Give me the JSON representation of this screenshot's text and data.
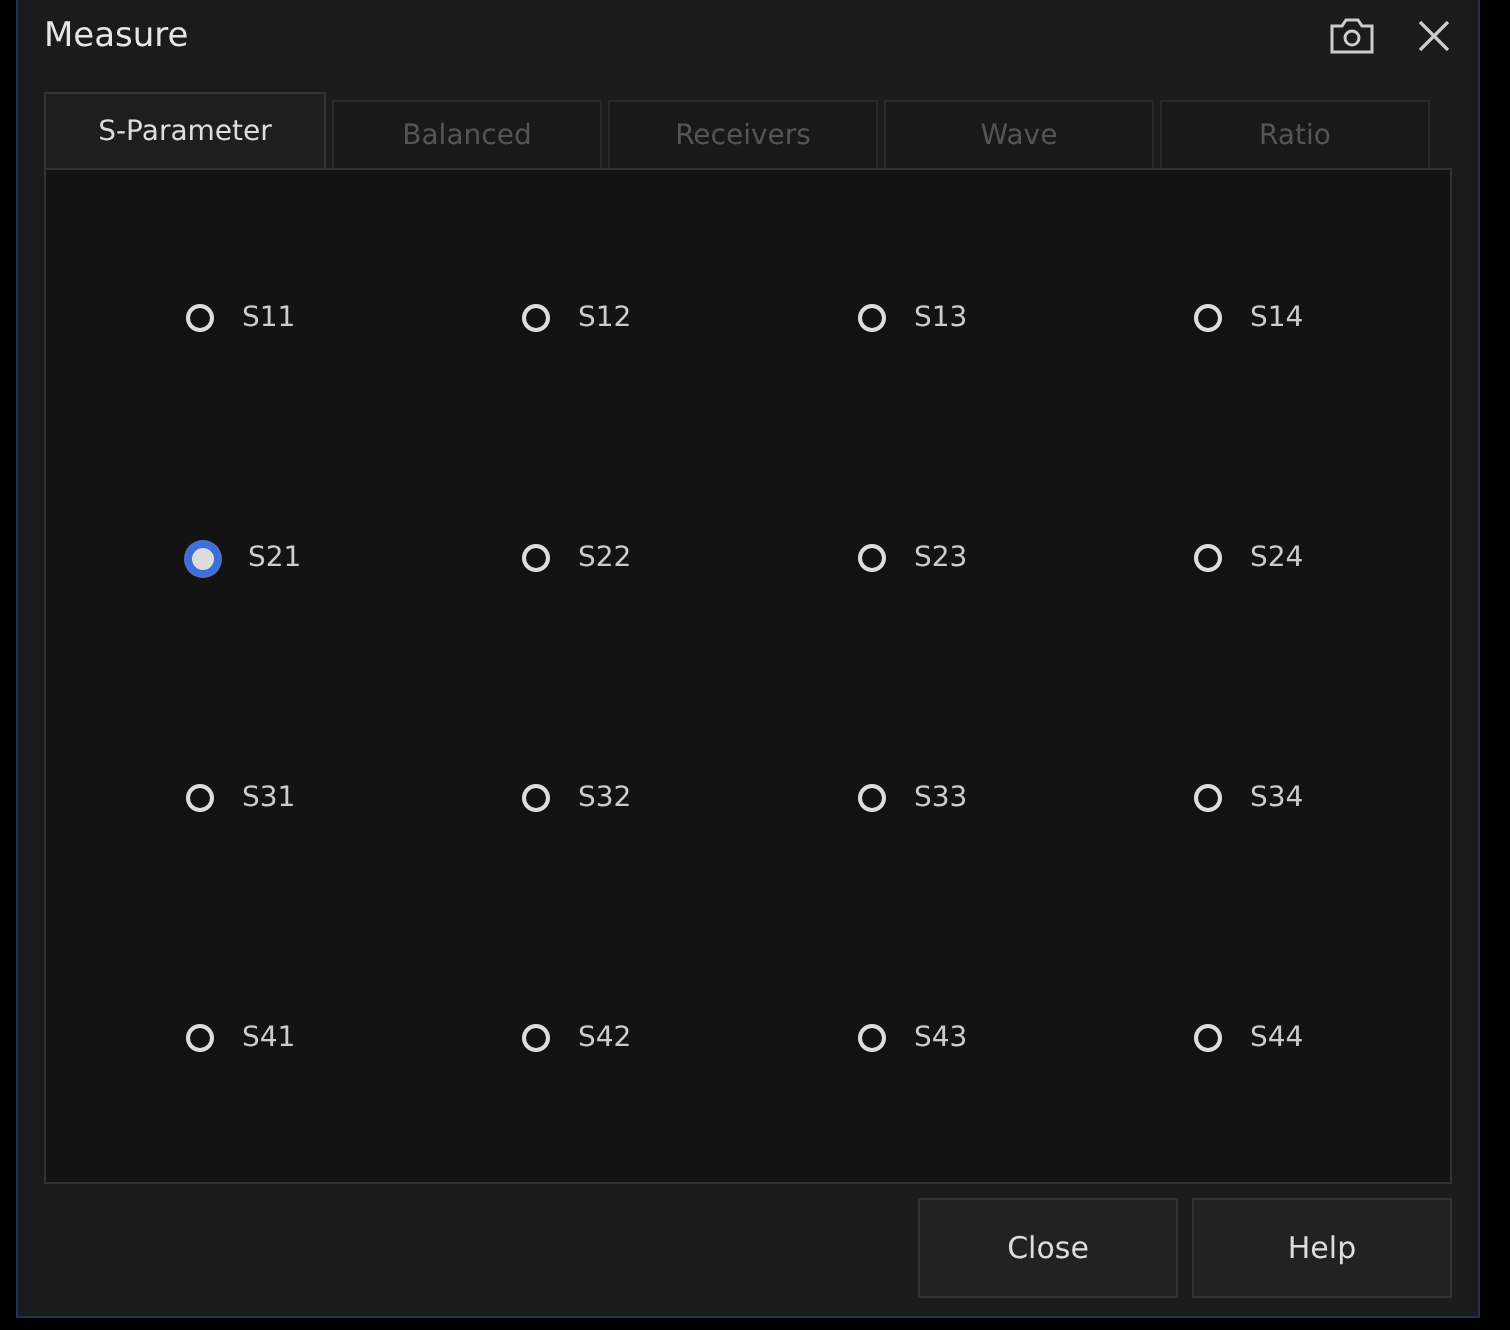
{
  "window": {
    "title": "Measure"
  },
  "tabs": [
    {
      "label": "S-Parameter",
      "selected": true
    },
    {
      "label": "Balanced",
      "selected": false
    },
    {
      "label": "Receivers",
      "selected": false
    },
    {
      "label": "Wave",
      "selected": false
    },
    {
      "label": "Ratio",
      "selected": false
    }
  ],
  "parameters": [
    {
      "label": "S11",
      "selected": false
    },
    {
      "label": "S12",
      "selected": false
    },
    {
      "label": "S13",
      "selected": false
    },
    {
      "label": "S14",
      "selected": false
    },
    {
      "label": "S21",
      "selected": true
    },
    {
      "label": "S22",
      "selected": false
    },
    {
      "label": "S23",
      "selected": false
    },
    {
      "label": "S24",
      "selected": false
    },
    {
      "label": "S31",
      "selected": false
    },
    {
      "label": "S32",
      "selected": false
    },
    {
      "label": "S33",
      "selected": false
    },
    {
      "label": "S34",
      "selected": false
    },
    {
      "label": "S41",
      "selected": false
    },
    {
      "label": "S42",
      "selected": false
    },
    {
      "label": "S43",
      "selected": false
    },
    {
      "label": "S44",
      "selected": false
    }
  ],
  "buttons": [
    "Close",
    "Help"
  ]
}
